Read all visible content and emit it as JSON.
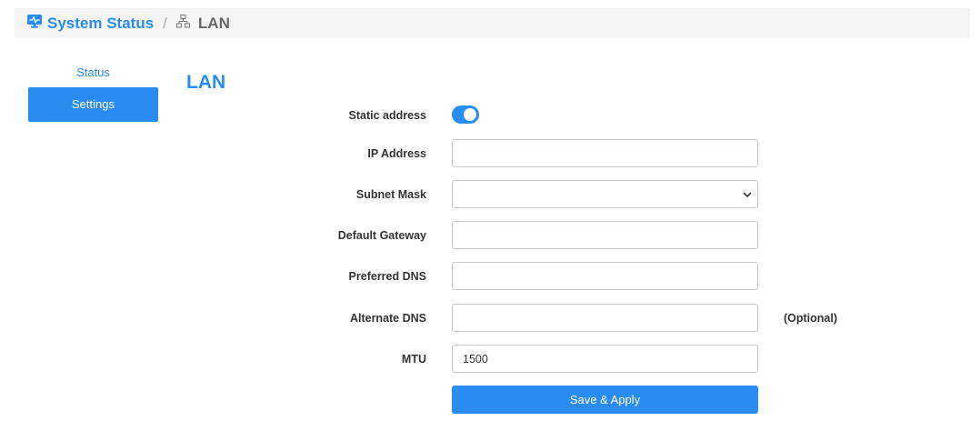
{
  "breadcrumb": {
    "root_label": "System Status",
    "separator": "/",
    "current_label": "LAN"
  },
  "sidebar": {
    "items": [
      {
        "label": "Status",
        "active": false
      },
      {
        "label": "Settings",
        "active": true
      }
    ]
  },
  "page": {
    "title": "LAN"
  },
  "form": {
    "static_address": {
      "label": "Static address",
      "enabled": true
    },
    "ip_address": {
      "label": "IP Address",
      "value": ""
    },
    "subnet_mask": {
      "label": "Subnet Mask",
      "selected": ""
    },
    "default_gateway": {
      "label": "Default Gateway",
      "value": ""
    },
    "preferred_dns": {
      "label": "Preferred DNS",
      "value": ""
    },
    "alternate_dns": {
      "label": "Alternate DNS",
      "value": "",
      "note": "(Optional)"
    },
    "mtu": {
      "label": "MTU",
      "value": "1500"
    }
  },
  "actions": {
    "save_label": "Save & Apply"
  },
  "colors": {
    "accent": "#2a8cf0",
    "breadcrumb_bg": "#f5f5f5"
  },
  "icons": {
    "breadcrumb_root": "monitor-icon",
    "breadcrumb_current": "network-topology-icon",
    "select_arrow": "chevron-down-icon"
  }
}
